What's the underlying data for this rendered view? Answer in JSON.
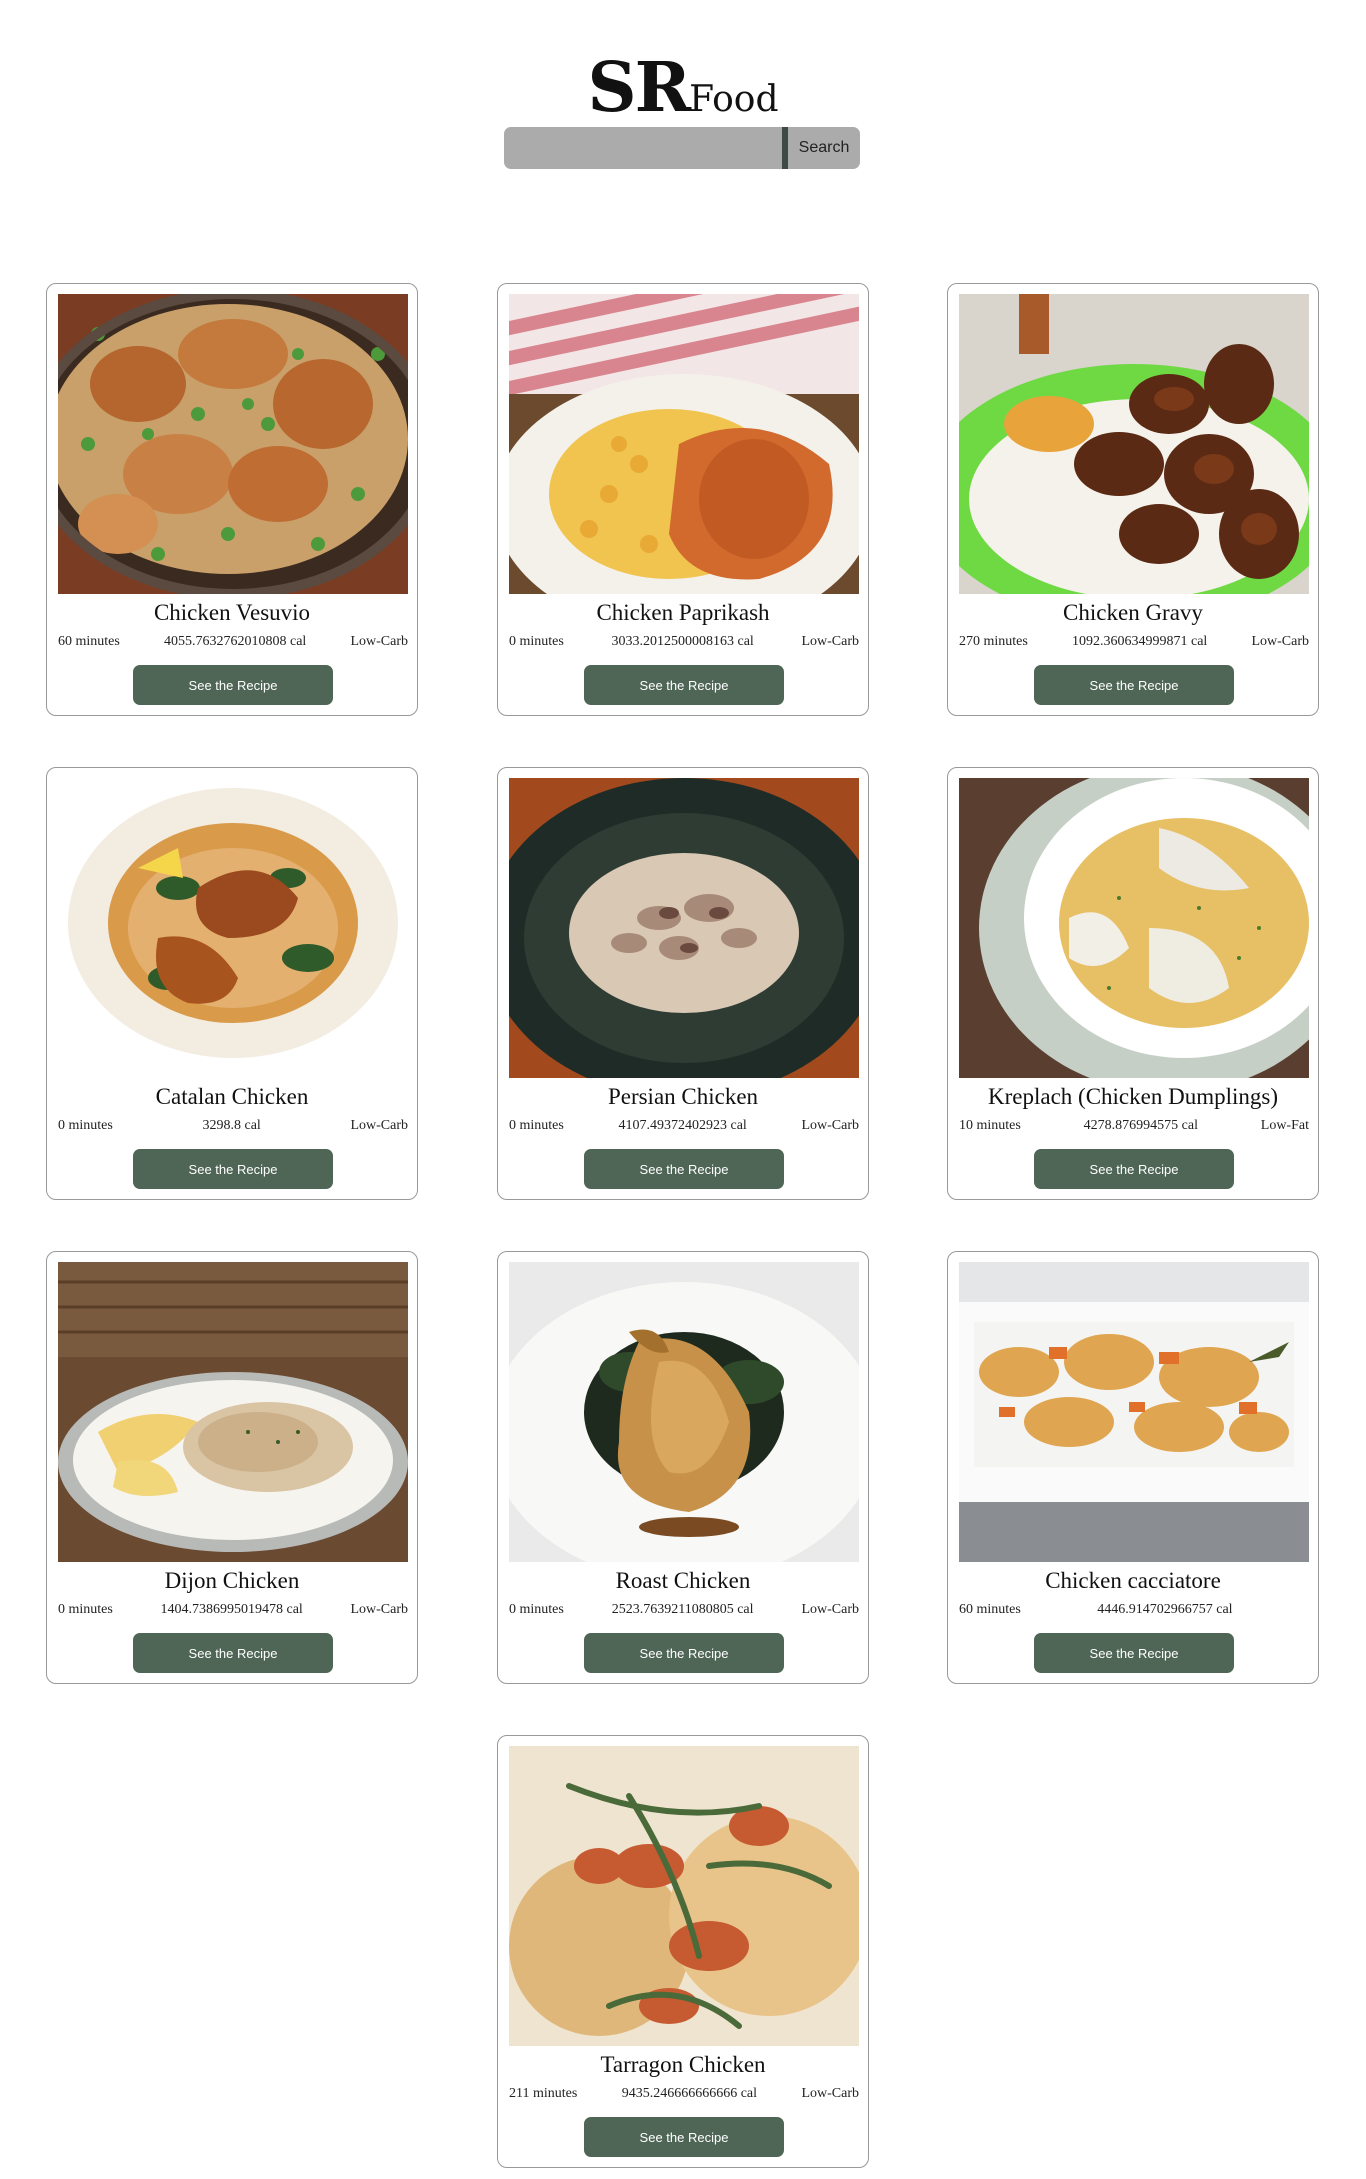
{
  "brand": {
    "big": "SR",
    "small": "Food"
  },
  "search": {
    "placeholder": "",
    "button": "Search"
  },
  "recipes": [
    {
      "title": "Chicken Vesuvio",
      "time": "60 minutes",
      "calories": "4055.7632762010808 cal",
      "diet": "Low-Carb",
      "button": "See the Recipe"
    },
    {
      "title": "Chicken Paprikash",
      "time": "0 minutes",
      "calories": "3033.2012500008163 cal",
      "diet": "Low-Carb",
      "button": "See the Recipe"
    },
    {
      "title": "Chicken Gravy",
      "time": "270 minutes",
      "calories": "1092.360634999871 cal",
      "diet": "Low-Carb",
      "button": "See the Recipe"
    },
    {
      "title": "Catalan Chicken",
      "time": "0 minutes",
      "calories": "3298.8 cal",
      "diet": "Low-Carb",
      "button": "See the Recipe"
    },
    {
      "title": "Persian Chicken",
      "time": "0 minutes",
      "calories": "4107.49372402923 cal",
      "diet": "Low-Carb",
      "button": "See the Recipe"
    },
    {
      "title": "Kreplach (Chicken Dumplings)",
      "time": "10 minutes",
      "calories": "4278.876994575 cal",
      "diet": "Low-Fat",
      "button": "See the Recipe"
    },
    {
      "title": "Dijon Chicken",
      "time": "0 minutes",
      "calories": "1404.7386995019478 cal",
      "diet": "Low-Carb",
      "button": "See the Recipe"
    },
    {
      "title": "Roast Chicken",
      "time": "0 minutes",
      "calories": "2523.7639211080805 cal",
      "diet": "Low-Carb",
      "button": "See the Recipe"
    },
    {
      "title": "Chicken cacciatore",
      "time": "60 minutes",
      "calories": "4446.914702966757 cal",
      "diet": "",
      "button": "See the Recipe"
    },
    {
      "title": "Tarragon Chicken",
      "time": "211 minutes",
      "calories": "9435.246666666666 cal",
      "diet": "Low-Carb",
      "button": "See the Recipe"
    }
  ]
}
